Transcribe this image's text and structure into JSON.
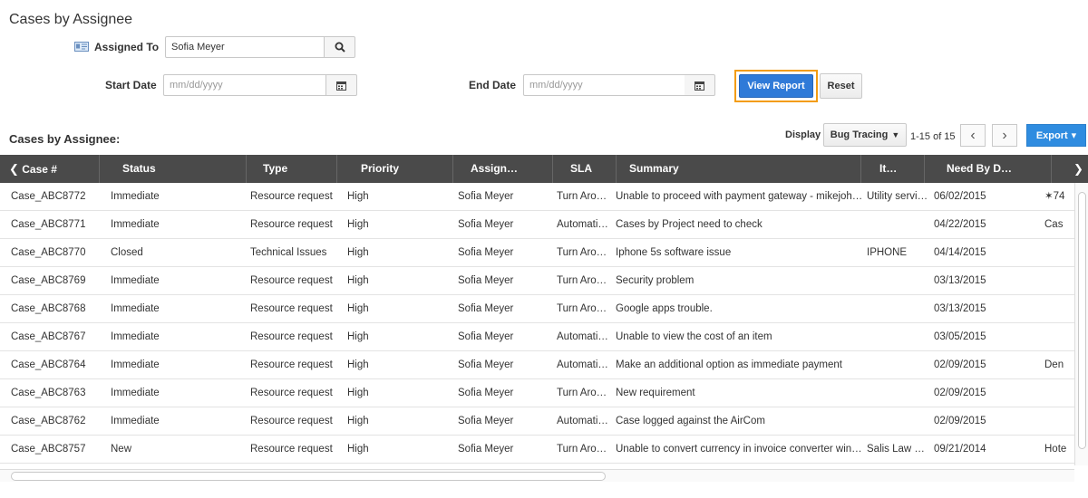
{
  "page": {
    "title": "Cases by Assignee"
  },
  "form": {
    "assigned_to_label": "Assigned To",
    "assigned_to_value": "Sofia Meyer",
    "start_date_label": "Start Date",
    "start_date_placeholder": "mm/dd/yyyy",
    "end_date_label": "End Date",
    "end_date_placeholder": "mm/dd/yyyy",
    "view_report_label": "View Report",
    "reset_label": "Reset"
  },
  "report": {
    "section_title": "Cases by Assignee:",
    "display_label": "Display",
    "display_value": "Bug Tracing",
    "pager_text": "1-15 of 15",
    "prev_glyph": "‹",
    "next_glyph": "›",
    "export_label": "Export",
    "export_caret": "▾"
  },
  "columns": [
    "Case #",
    "Status",
    "Type",
    "Priority",
    "Assign…",
    "SLA",
    "Summary",
    "It…",
    "Need By D…"
  ],
  "rows": [
    [
      "Case_ABC8772",
      "Immediate",
      "Resource request",
      "High",
      "Sofia Meyer",
      "Turn Aro…",
      "Unable to proceed with payment gateway - mikejoh…",
      "Utility servi…",
      "06/02/2015",
      "✶74"
    ],
    [
      "Case_ABC8771",
      "Immediate",
      "Resource request",
      "High",
      "Sofia Meyer",
      "Automati…",
      "Cases by Project need to check",
      "",
      "04/22/2015",
      "Cas"
    ],
    [
      "Case_ABC8770",
      "Closed",
      "Technical Issues",
      "High",
      "Sofia Meyer",
      "Turn Aro…",
      "Iphone 5s software issue",
      "IPHONE",
      "04/14/2015",
      ""
    ],
    [
      "Case_ABC8769",
      "Immediate",
      "Resource request",
      "High",
      "Sofia Meyer",
      "Turn Aro…",
      "Security problem",
      "",
      "03/13/2015",
      ""
    ],
    [
      "Case_ABC8768",
      "Immediate",
      "Resource request",
      "High",
      "Sofia Meyer",
      "Turn Aro…",
      "Google apps trouble.",
      "",
      "03/13/2015",
      ""
    ],
    [
      "Case_ABC8767",
      "Immediate",
      "Resource request",
      "High",
      "Sofia Meyer",
      "Automati…",
      "Unable to view the cost of an item",
      "",
      "03/05/2015",
      ""
    ],
    [
      "Case_ABC8764",
      "Immediate",
      "Resource request",
      "High",
      "Sofia Meyer",
      "Automati…",
      "Make an additional option as immediate payment",
      "",
      "02/09/2015",
      "Den"
    ],
    [
      "Case_ABC8763",
      "Immediate",
      "Resource request",
      "High",
      "Sofia Meyer",
      "Turn Aro…",
      "New requirement",
      "",
      "02/09/2015",
      ""
    ],
    [
      "Case_ABC8762",
      "Immediate",
      "Resource request",
      "High",
      "Sofia Meyer",
      "Automati…",
      "Case logged against the AirCom",
      "",
      "02/09/2015",
      ""
    ],
    [
      "Case_ABC8757",
      "New",
      "Resource request",
      "High",
      "Sofia Meyer",
      "Turn Aro…",
      "Unable to convert currency in invoice converter win…",
      "Salis Law …",
      "09/21/2014",
      "Hote"
    ]
  ],
  "icons": {
    "assignee": "contact-card-icon",
    "search": "search-icon",
    "calendar": "calendar-icon",
    "scroll_left": "chevron-left-icon",
    "scroll_right": "chevron-right-icon"
  },
  "colors": {
    "accent": "#2f7ad8",
    "highlight": "#f39c12",
    "header_bg": "#4a4a4a"
  }
}
